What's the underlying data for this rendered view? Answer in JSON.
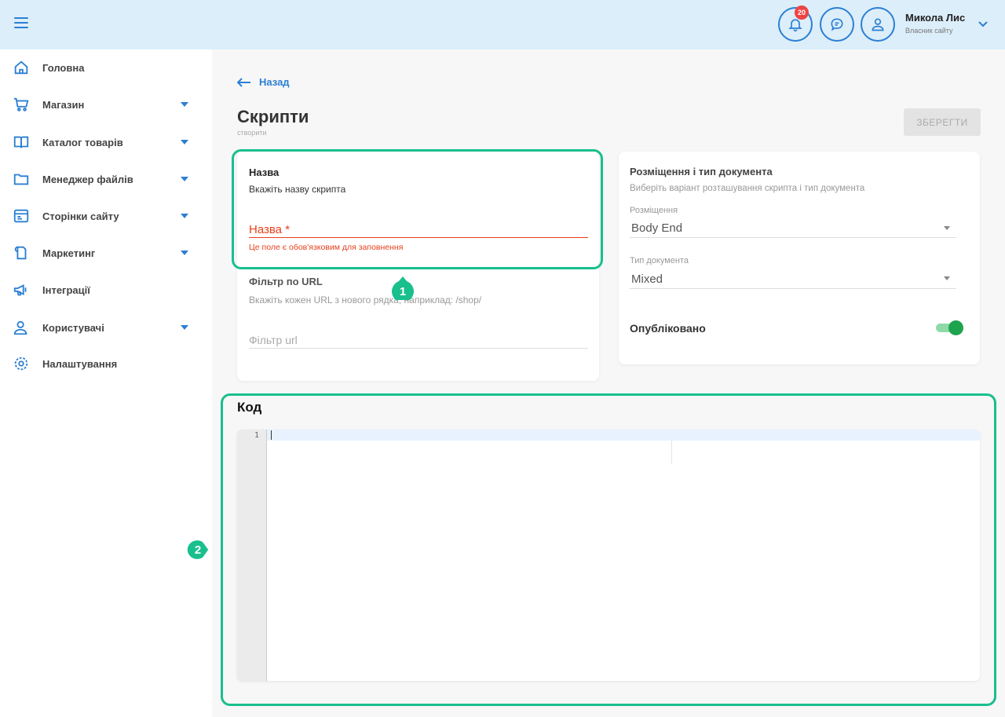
{
  "header": {
    "notifications_count": "20",
    "user_name": "Микола Лис",
    "user_subtitle": "Власник сайту"
  },
  "sidebar": {
    "items": [
      {
        "label": "Головна",
        "icon": "home-icon",
        "has_submenu": false
      },
      {
        "label": "Магазин",
        "icon": "cart-icon",
        "has_submenu": true
      },
      {
        "label": "Каталог товарів",
        "icon": "book-icon",
        "has_submenu": true
      },
      {
        "label": "Менеджер файлів",
        "icon": "folder-icon",
        "has_submenu": true
      },
      {
        "label": "Сторінки сайту",
        "icon": "pages-icon",
        "has_submenu": true
      },
      {
        "label": "Маркетинг",
        "icon": "marketing-icon",
        "has_submenu": true
      },
      {
        "label": "Інтеграції",
        "icon": "megaphone-icon",
        "has_submenu": false
      },
      {
        "label": "Користувачі",
        "icon": "users-icon",
        "has_submenu": true
      },
      {
        "label": "Налаштування",
        "icon": "settings-icon",
        "has_submenu": false
      }
    ]
  },
  "page": {
    "back_label": "Назад",
    "title": "Скрипти",
    "subtitle": "створити",
    "save_label": "ЗБЕРЕГТИ"
  },
  "name_card": {
    "title": "Назва",
    "description": "Вкажіть назву скрипта",
    "field_placeholder": "Назва *",
    "error": "Це поле є обов'язковим для заповнення"
  },
  "url_card": {
    "title": "Фільтр по URL",
    "description": "Вкажіть кожен URL з нового рядка, наприклад: /shop/",
    "field_placeholder": "Фільтр url"
  },
  "placement_card": {
    "title": "Розміщення і тип документа",
    "description": "Виберіть варіант розташування скрипта і тип документа",
    "placement_label": "Розміщення",
    "placement_value": "Body End",
    "doctype_label": "Тип документа",
    "doctype_value": "Mixed",
    "published_label": "Опубліковано",
    "published": true
  },
  "code": {
    "title": "Код",
    "line_number": "1"
  },
  "annotations": {
    "marker_1": "1",
    "marker_2": "2",
    "color": "#19bf8d"
  },
  "colors": {
    "accent": "#2b7fd3",
    "header_bg": "#dceefa",
    "error": "#e8401c",
    "toggle_on": "#1ea34f"
  }
}
